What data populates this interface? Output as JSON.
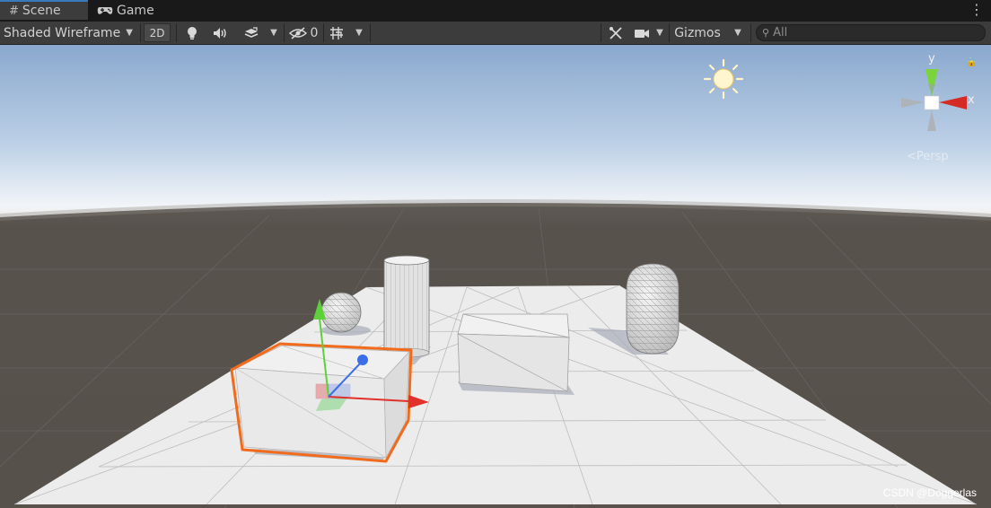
{
  "tabs": [
    {
      "label": "Scene",
      "icon": "grid-hash-icon",
      "active": true
    },
    {
      "label": "Game",
      "icon": "gamepad-icon",
      "active": false
    }
  ],
  "toolbar": {
    "draw_mode": "Shaded Wireframe",
    "two_d_label": "2D",
    "hidden_count": "0",
    "gizmos_label": "Gizmos"
  },
  "search": {
    "placeholder": "All",
    "value": ""
  },
  "viewport": {
    "orientation_gizmo": {
      "y_label": "y",
      "x_label": "x",
      "projection_label": "Persp"
    },
    "objects": [
      "cube (selected)",
      "sphere",
      "cylinder",
      "cube",
      "capsule",
      "plane"
    ]
  },
  "watermark": "CSDN @Doggerlas",
  "colors": {
    "tab_accent": "#3a79bb",
    "selection_outline": "#f26b1d",
    "axis_x": "#e0312b",
    "axis_y": "#5ed13a",
    "axis_z": "#3b6fe8"
  }
}
